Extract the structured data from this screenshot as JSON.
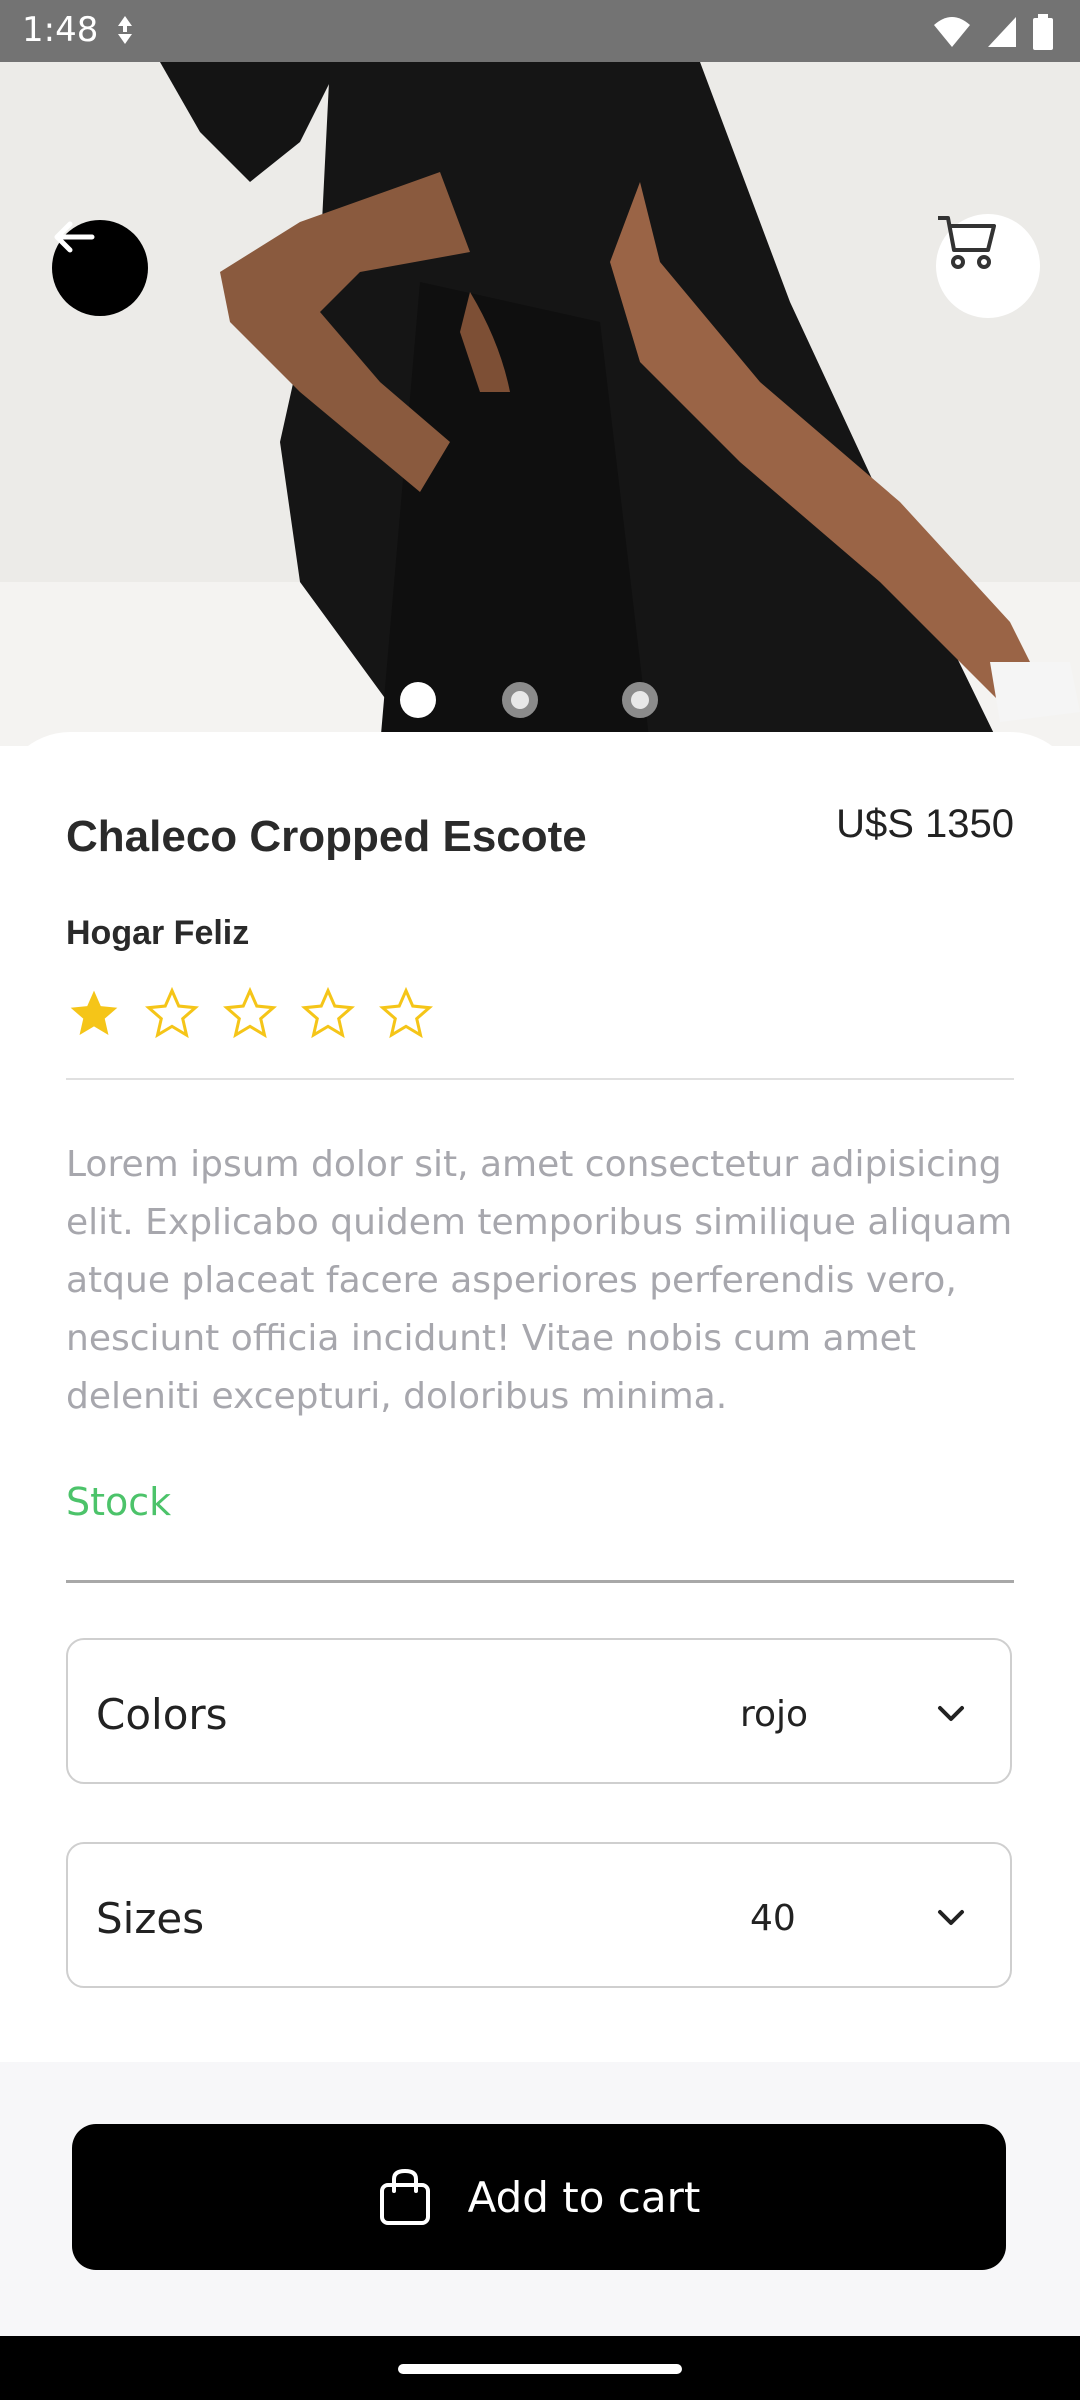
{
  "status_bar": {
    "time": "1:48",
    "icons": [
      "data-saver-icon",
      "wifi-icon",
      "signal-icon",
      "battery-icon"
    ]
  },
  "hero": {
    "image_alt": "Woman in black dress",
    "back_icon": "arrow-left-icon",
    "cart_icon": "cart-icon",
    "carousel": {
      "count": 3,
      "active_index": 0
    }
  },
  "product": {
    "title": "Chaleco Cropped Escote",
    "price": "U$S 1350",
    "brand": "Hogar Feliz",
    "rating": {
      "value": 1,
      "max": 5
    },
    "description": "Lorem ipsum dolor sit, amet consectetur adipisicing elit. Explicabo quidem temporibus similique aliquam atque placeat facere asperiores perferendis vero, nesciunt officia incidunt! Vitae nobis cum amet deleniti excepturi, doloribus minima.",
    "stock_label": "Stock"
  },
  "selectors": {
    "colors": {
      "label": "Colors",
      "value": "rojo"
    },
    "sizes": {
      "label": "Sizes",
      "value": "40"
    }
  },
  "cta": {
    "label": "Add to cart",
    "icon": "shopping-bag-icon"
  },
  "colors": {
    "accent_black": "#000000",
    "star_yellow": "#F5C518",
    "stock_green": "#4CC36A",
    "description_gray": "#A7A7AD"
  }
}
